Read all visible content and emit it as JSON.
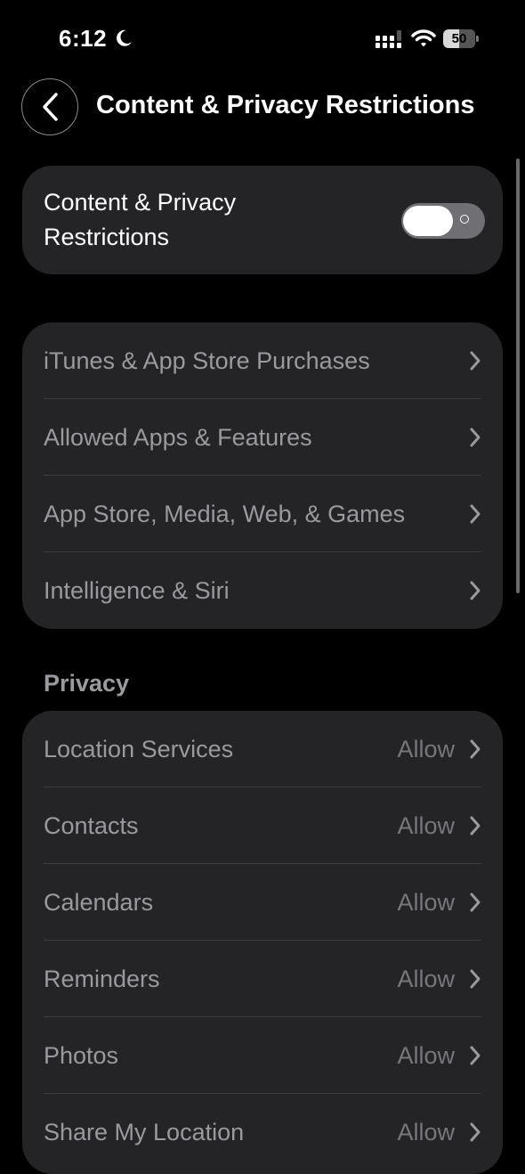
{
  "status_bar": {
    "time": "6:12",
    "battery": "50"
  },
  "nav": {
    "title": "Content & Privacy Restrictions"
  },
  "master_toggle": {
    "label": "Content & Privacy Restrictions",
    "state": "off"
  },
  "menu": {
    "items": [
      {
        "label": "iTunes & App Store Purchases"
      },
      {
        "label": "Allowed Apps & Features"
      },
      {
        "label": "App Store, Media, Web, & Games"
      },
      {
        "label": "Intelligence & Siri"
      }
    ]
  },
  "privacy": {
    "header": "Privacy",
    "items": [
      {
        "label": "Location Services",
        "value": "Allow"
      },
      {
        "label": "Contacts",
        "value": "Allow"
      },
      {
        "label": "Calendars",
        "value": "Allow"
      },
      {
        "label": "Reminders",
        "value": "Allow"
      },
      {
        "label": "Photos",
        "value": "Allow"
      },
      {
        "label": "Share My Location",
        "value": "Allow"
      }
    ]
  },
  "colors": {
    "background": "#000000",
    "card": "#242426",
    "label_dimmed": "#9a9a9e",
    "value": "#77777b"
  },
  "icons": [
    "moon-icon",
    "signal-icon",
    "wifi-icon",
    "battery-icon",
    "back-chevron-icon",
    "chevron-right-icon"
  ]
}
